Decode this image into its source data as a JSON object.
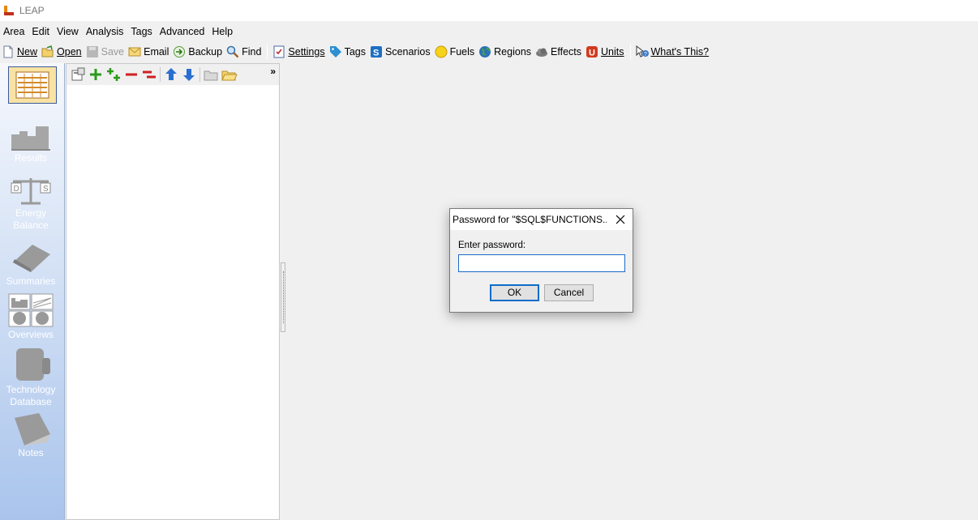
{
  "window": {
    "title": "LEAP",
    "logo_icon": "leap-logo-icon"
  },
  "menu": [
    "Area",
    "Edit",
    "View",
    "Analysis",
    "Tags",
    "Advanced",
    "Help"
  ],
  "toolbar": {
    "new": "New",
    "open": "Open",
    "save": "Save",
    "email": "Email",
    "backup": "Backup",
    "find": "Find",
    "settings": "Settings",
    "tags": "Tags",
    "scenarios": "Scenarios",
    "fuels": "Fuels",
    "regions": "Regions",
    "effects": "Effects",
    "units": "Units",
    "whats_this": "What's This?"
  },
  "sidebar": {
    "items": [
      {
        "label": "",
        "icon": "analysis-view-icon",
        "selected": true
      },
      {
        "label": "Results",
        "icon": "results-chart-icon"
      },
      {
        "label": "Energy Balance",
        "icon": "balance-scale-icon"
      },
      {
        "label": "Summaries",
        "icon": "summaries-icon"
      },
      {
        "label": "Overviews",
        "icon": "overviews-icon"
      },
      {
        "label": "Technology Database",
        "icon": "database-icon"
      },
      {
        "label": "Notes",
        "icon": "notes-icon"
      }
    ]
  },
  "tree_toolbar": {
    "more": "»"
  },
  "dialog": {
    "title": "Password for \"$SQL$FUNCTIONS....",
    "prompt": "Enter password:",
    "password_value": "",
    "ok": "OK",
    "cancel": "Cancel"
  }
}
